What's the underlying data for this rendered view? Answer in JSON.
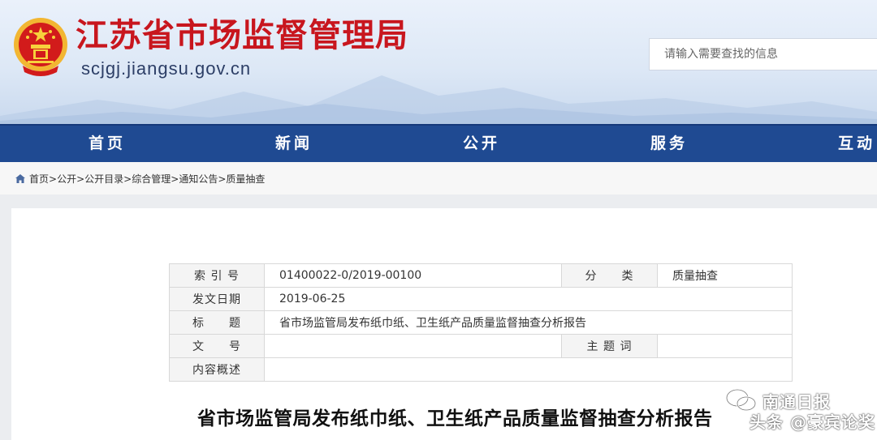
{
  "header": {
    "site_name": "江苏省市场监督管理局",
    "domain": "scjgj.jiangsu.gov.cn",
    "search_placeholder": "请输入需要查找的信息"
  },
  "nav": {
    "items": [
      {
        "label": "首页"
      },
      {
        "label": "新闻"
      },
      {
        "label": "公开"
      },
      {
        "label": "服务"
      },
      {
        "label": "互动"
      }
    ]
  },
  "breadcrumb": {
    "items": [
      "首页",
      "公开",
      "公开目录",
      "综合管理",
      "通知公告",
      "质量抽查"
    ],
    "separator": ">"
  },
  "info_table": {
    "index_label": "索 引 号",
    "index_value": "01400022-0/2019-00100",
    "category_label": "分　　类",
    "category_value": "质量抽查",
    "date_label": "发文日期",
    "date_value": "2019-06-25",
    "title_label": "标　　题",
    "title_value": "省市场监管局发布纸巾纸、卫生纸产品质量监督抽查分析报告",
    "docno_label": "文　　号",
    "docno_value": "",
    "keywords_label": "主 题 词",
    "keywords_value": "",
    "summary_label": "内容概述",
    "summary_value": ""
  },
  "article": {
    "title": "省市场监管局发布纸巾纸、卫生纸产品质量监督抽查分析报告"
  },
  "watermark": {
    "source": "南通日报",
    "credit": "头条 @豪宾论奖"
  },
  "colors": {
    "nav_bg": "#1f4a92",
    "brand_red": "#c8161e",
    "domain_text": "#2c3e66"
  }
}
